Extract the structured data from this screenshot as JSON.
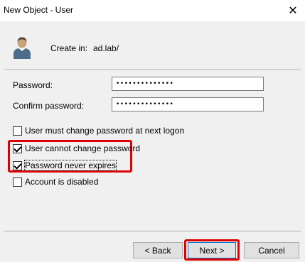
{
  "window": {
    "title": "New Object - User",
    "close_glyph": "✕"
  },
  "header": {
    "create_in_label": "Create in:",
    "create_in_value": "ad.lab/"
  },
  "password": {
    "label": "Password:",
    "value": "••••••••••••••"
  },
  "confirm_password": {
    "label": "Confirm password:",
    "value": "••••••••••••••"
  },
  "options": [
    {
      "label": "User must change password at next logon",
      "checked": false
    },
    {
      "label": "User cannot change password",
      "checked": true
    },
    {
      "label": "Password never expires",
      "checked": true
    },
    {
      "label": "Account is disabled",
      "checked": false
    }
  ],
  "buttons": {
    "back": "< Back",
    "next": "Next >",
    "cancel": "Cancel"
  },
  "colors": {
    "highlight": "#e00000",
    "background": "#f0f0f0"
  },
  "icons": {
    "user": "user-icon",
    "close": "close-icon"
  }
}
